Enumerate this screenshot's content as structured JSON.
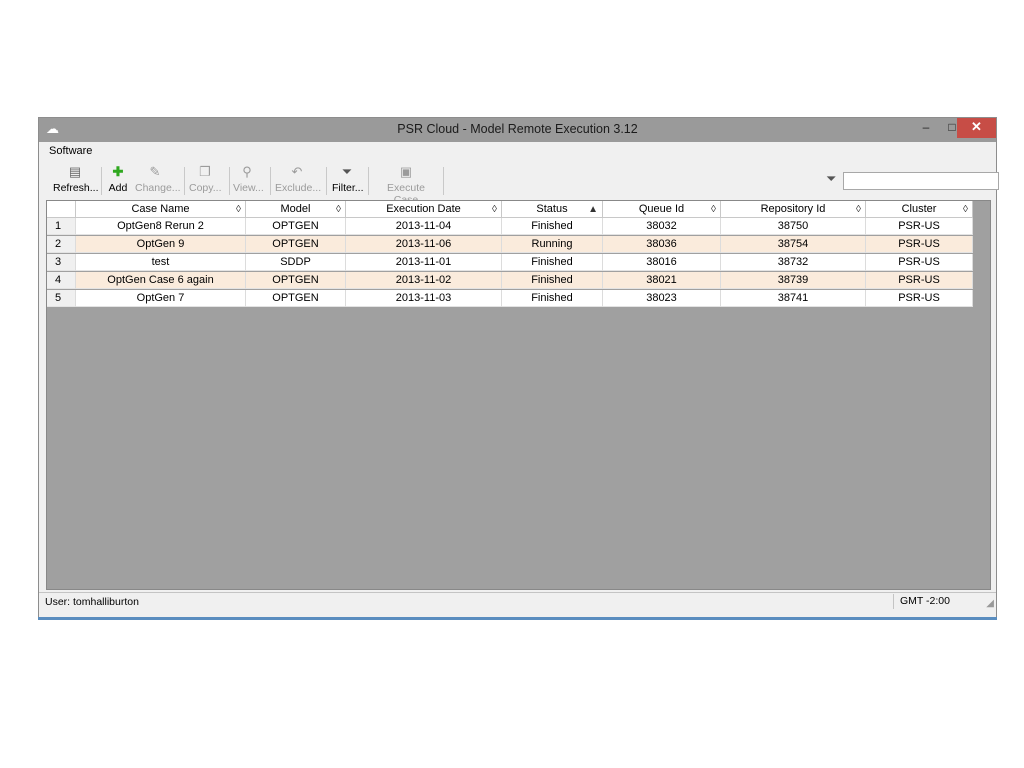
{
  "window": {
    "title": "PSR Cloud - Model Remote Execution 3.12",
    "min_symbol": "–",
    "max_symbol": "□",
    "close_symbol": "✕"
  },
  "menu": {
    "items": [
      {
        "label": "Software"
      }
    ]
  },
  "toolbar": {
    "buttons": [
      {
        "label": "Refresh...",
        "icon": "refresh-icon",
        "enabled": true
      },
      {
        "label": "Add",
        "icon": "add-icon",
        "enabled": true
      },
      {
        "label": "Change...",
        "icon": "change-icon",
        "enabled": false
      },
      {
        "label": "Copy...",
        "icon": "copy-icon",
        "enabled": false
      },
      {
        "label": "View...",
        "icon": "view-icon",
        "enabled": false
      },
      {
        "label": "Exclude...",
        "icon": "exclude-icon",
        "enabled": false
      },
      {
        "label": "Filter...",
        "icon": "filter-icon",
        "enabled": true
      },
      {
        "label": "Execute Case",
        "icon": "execute-icon",
        "enabled": false
      }
    ],
    "filter_value": ""
  },
  "table": {
    "columns": [
      "Case Name",
      "Model",
      "Execution Date",
      "Status",
      "Queue Id",
      "Repository Id",
      "Cluster"
    ],
    "sort_indicators": [
      "◊",
      "◊",
      "◊",
      "▲",
      "◊",
      "◊",
      "◊"
    ],
    "rows": [
      {
        "num": "1",
        "cells": [
          "OptGen8 Rerun 2",
          "OPTGEN",
          "2013-11-04",
          "Finished",
          "38032",
          "38750",
          "PSR-US"
        ]
      },
      {
        "num": "2",
        "cells": [
          "OptGen 9",
          "OPTGEN",
          "2013-11-06",
          "Running",
          "38036",
          "38754",
          "PSR-US"
        ]
      },
      {
        "num": "3",
        "cells": [
          "test",
          "SDDP",
          "2013-11-01",
          "Finished",
          "38016",
          "38732",
          "PSR-US"
        ]
      },
      {
        "num": "4",
        "cells": [
          "OptGen Case 6 again",
          "OPTGEN",
          "2013-11-02",
          "Finished",
          "38021",
          "38739",
          "PSR-US"
        ]
      },
      {
        "num": "5",
        "cells": [
          "OptGen 7",
          "OPTGEN",
          "2013-11-03",
          "Finished",
          "38023",
          "38741",
          "PSR-US"
        ]
      }
    ]
  },
  "status": {
    "user": "User: tomhalliburton",
    "timezone": "GMT -2:00"
  }
}
